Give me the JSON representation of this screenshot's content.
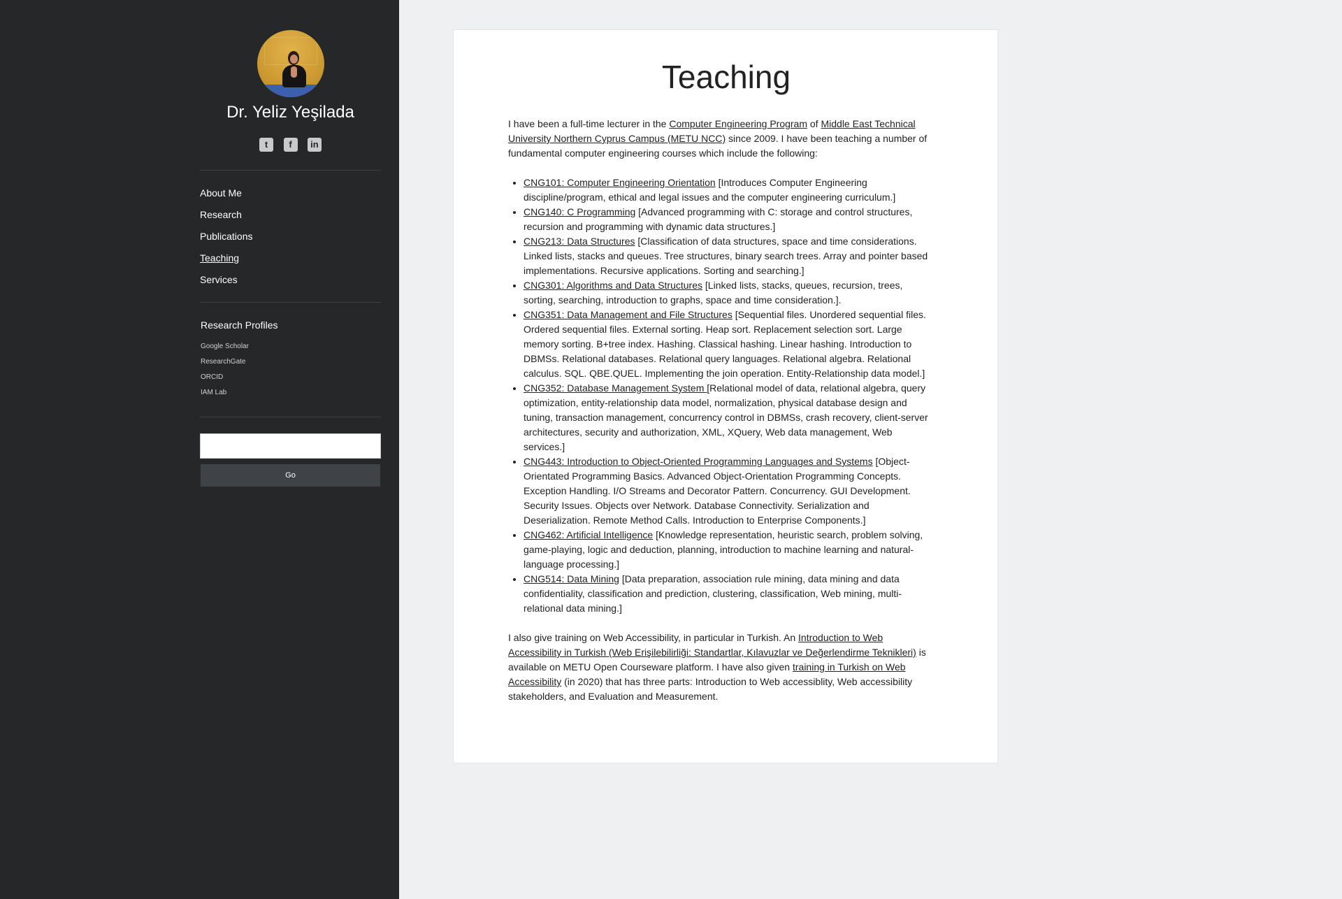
{
  "sidebar": {
    "name": "Dr. Yeliz Yeşilada",
    "socials": [
      {
        "icon": "twitter-icon",
        "glyph": "t"
      },
      {
        "icon": "facebook-icon",
        "glyph": "f"
      },
      {
        "icon": "linkedin-icon",
        "glyph": "in"
      }
    ],
    "nav": [
      {
        "label": "About Me",
        "active": false
      },
      {
        "label": "Research",
        "active": false
      },
      {
        "label": "Publications",
        "active": false
      },
      {
        "label": "Teaching",
        "active": true
      },
      {
        "label": "Services",
        "active": false
      }
    ],
    "profiles_title": "Research Profiles",
    "profiles": [
      "Google Scholar",
      "ResearchGate",
      "ORCID",
      "IAM Lab"
    ],
    "search": {
      "value": "",
      "placeholder": ""
    },
    "go_label": "Go"
  },
  "main": {
    "title": "Teaching",
    "intro": {
      "t1": "I have been a full-time lecturer in the ",
      "link1": "Computer Engineering Program",
      "t2": " of ",
      "link2": "Middle East Technical University Northern Cyprus Campus (METU NCC)",
      "t3": " since 2009. I have been teaching a number of fundamental computer engineering courses which include the following:"
    },
    "courses": [
      {
        "link": "CNG101: Computer Engineering Orientation",
        "desc": " [Introduces Computer Engineering discipline/program, ethical and legal issues and the computer engineering curriculum.]"
      },
      {
        "link": "CNG140: C Programming",
        "desc": " [Advanced programming with C: storage and control structures, recursion and programming with dynamic data structures.]"
      },
      {
        "link": "CNG213: Data Structures",
        "desc": " [Classification of data structures, space and time considerations. Linked lists, stacks and queues. Tree structures, binary search trees. Array and pointer based implementations. Recursive applications. Sorting and searching.]"
      },
      {
        "link": "CNG301: Algorithms and Data Structures",
        "desc": " [Linked lists, stacks, queues, recursion, trees, sorting, searching, introduction to graphs, space and time consideration.]."
      },
      {
        "link": "CNG351: Data Management and File Structures",
        "desc": " [Sequential files. Unordered sequential files. Ordered sequential files. External sorting. Heap sort. Replacement selection sort. Large memory sorting. B+tree index. Hashing. Classical hashing. Linear hashing. Introduction to DBMSs. Relational databases. Relational query languages. Relational algebra. Relational calculus. SQL. QBE.QUEL. Implementing the join operation. Entity-Relationship data model.]"
      },
      {
        "link": "CNG352: Database Management System ",
        "desc": "[Relational model of data, relational algebra, query optimization, entity-relationship data model, normalization, physical database design and tuning, transaction management, concurrency control in DBMSs, crash recovery, client-server architectures, security and authorization, XML, XQuery, Web data management, Web services.]"
      },
      {
        "link": "CNG443: Introduction to Object-Oriented Programming Languages and Systems",
        "desc": " [Object-Orientated Programming Basics. Advanced Object-Orientation Programming Concepts. Exception Handling. I/O Streams and Decorator Pattern. Concurrency. GUI Development. Security Issues. Objects over Network. Database Connectivity. Serialization and Deserialization. Remote Method Calls. Introduction to Enterprise Components.]"
      },
      {
        "link": "CNG462: Artificial Intelligence",
        "desc": " [Knowledge representation, heuristic search, problem solving, game-playing, logic and deduction, planning, introduction to machine learning and natural-language processing.]"
      },
      {
        "link": "CNG514: Data Mining",
        "desc": " [Data preparation, association rule mining, data mining and data confidentiality, classification and prediction, clustering, classification, Web mining, multi-relational data mining.]"
      }
    ],
    "outro": {
      "t1": "I also give training on Web Accessibility, in particular in Turkish. An ",
      "link1": "Introduction to Web Accessibility in Turkish (Web Erişilebilirliği: Standartlar, Kılavuzlar ve Değerlendirme Teknikleri)",
      "t2": " is available on METU Open Courseware platform. I have also given ",
      "link2": "training in Turkish on Web Accessibility",
      "t3": " (in 2020) that has three parts: Introduction to Web accessiblity, Web accessibility stakeholders, and Evaluation and Measurement."
    }
  }
}
